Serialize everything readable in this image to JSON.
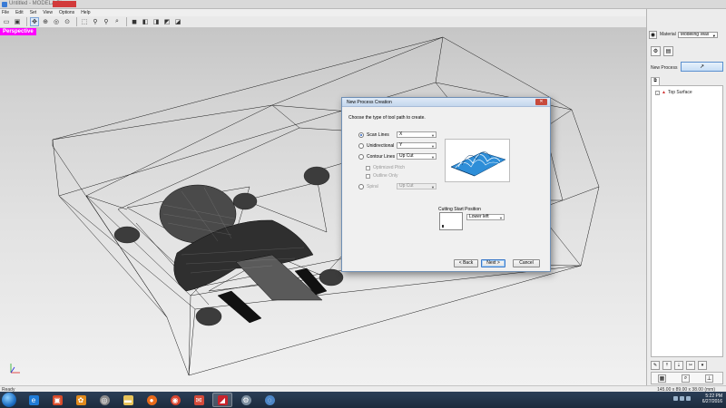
{
  "window": {
    "title": "Untitled - MODELA Player"
  },
  "menu": [
    "File",
    "Edit",
    "Set",
    "View",
    "Options",
    "Help"
  ],
  "toolbar": {
    "icons": [
      "new-file-icon",
      "save-icon",
      "pan-icon",
      "rotate-icon",
      "orbit-icon",
      "zoom-in-icon",
      "zoom-out-icon",
      "zoom-window-icon",
      "zoom-extents-icon",
      "view-cube-front-icon",
      "view-cube-top-icon",
      "view-cube-right-icon",
      "view-cube-iso-icon",
      "view-cube-bottom-icon"
    ]
  },
  "viewport": {
    "label": "Perspective"
  },
  "dialog": {
    "title": "New Process Creation",
    "close": "✕",
    "prompt": "Choose the type of tool path to create.",
    "options": [
      {
        "label": "Scan Lines",
        "value": "X",
        "selected": true,
        "enabled": true
      },
      {
        "label": "Unidirectional",
        "value": "Y",
        "selected": false,
        "enabled": true
      },
      {
        "label": "Contour Lines",
        "value": "Up Cut",
        "selected": false,
        "enabled": true
      }
    ],
    "checks": [
      "Optimized Pitch",
      "Outline Only"
    ],
    "spiral": {
      "label": "Spiral",
      "value": "Up Cut",
      "enabled": false
    },
    "cutting_start_label": "Cutting Start Position",
    "cutting_start_value": "Lower left",
    "buttons": {
      "back": "< Back",
      "next": "Next >",
      "cancel": "Cancel"
    }
  },
  "right_panel": {
    "material_label": "Material",
    "material_value": "Modeling Wax",
    "new_process_label": "New Process",
    "tree": {
      "item": "Top Surface"
    }
  },
  "status": {
    "left": "Ready",
    "right": "145.00 x 89.00 x 38.00 (mm)"
  },
  "taskbar": {
    "time": "5:22 PM",
    "date": "6/27/2016"
  }
}
